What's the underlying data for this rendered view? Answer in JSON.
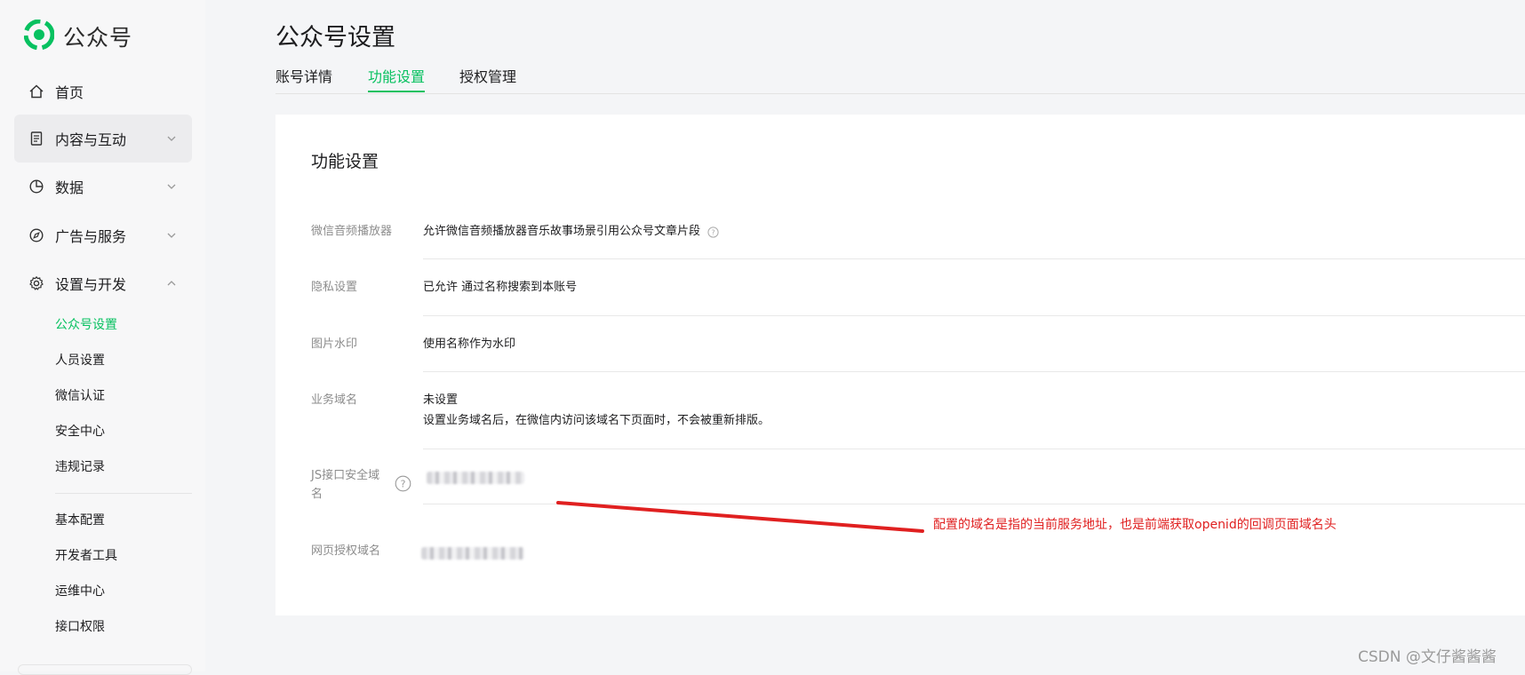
{
  "app": {
    "name": "公众号"
  },
  "sidebar": {
    "items": [
      {
        "label": "首页"
      },
      {
        "label": "内容与互动"
      },
      {
        "label": "数据"
      },
      {
        "label": "广告与服务"
      },
      {
        "label": "设置与开发"
      }
    ],
    "sub_items": [
      {
        "label": "公众号设置"
      },
      {
        "label": "人员设置"
      },
      {
        "label": "微信认证"
      },
      {
        "label": "安全中心"
      },
      {
        "label": "违规记录"
      },
      {
        "label": "基本配置"
      },
      {
        "label": "开发者工具"
      },
      {
        "label": "运维中心"
      },
      {
        "label": "接口权限"
      }
    ]
  },
  "header": {
    "title": "公众号设置",
    "tabs": [
      {
        "label": "账号详情"
      },
      {
        "label": "功能设置"
      },
      {
        "label": "授权管理"
      }
    ]
  },
  "card": {
    "title": "功能设置",
    "rows": [
      {
        "label": "微信音频播放器",
        "value": "允许微信音频播放器音乐故事场景引用公众号文章片段"
      },
      {
        "label": "隐私设置",
        "value": "已允许 通过名称搜索到本账号"
      },
      {
        "label": "图片水印",
        "value": "使用名称作为水印"
      },
      {
        "label": "业务域名",
        "value": "未设置",
        "note": "设置业务域名后，在微信内访问该域名下页面时，不会被重新排版。"
      },
      {
        "label_line1": "JS接口安全域",
        "label_line2": "名"
      },
      {
        "label": "网页授权域名"
      }
    ]
  },
  "annotation": {
    "text": "配置的域名是指的当前服务地址，也是前端获取openid的回调页面域名头",
    "color": "#e02020"
  },
  "watermark": "CSDN @文仔酱酱酱",
  "colors": {
    "accent": "#07c160",
    "annotation": "#e02020"
  }
}
